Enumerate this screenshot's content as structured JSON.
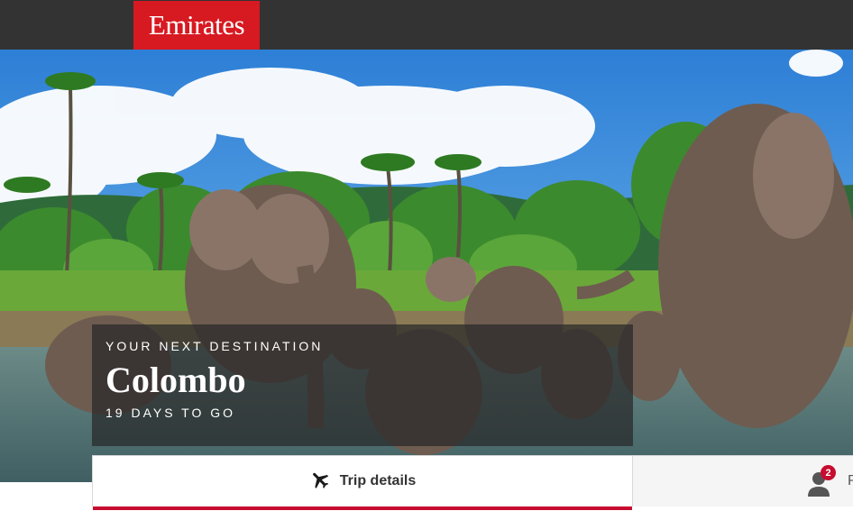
{
  "header": {
    "logo_text": "Emirates",
    "background_color": "#333333",
    "brand_color": "#d71921"
  },
  "hero": {
    "image_subject": "elephants bathing in river with palm trees",
    "eyebrow": "YOUR NEXT DESTINATION",
    "city": "Colombo",
    "countdown": "19 DAYS TO GO"
  },
  "tabs": {
    "trip_details": {
      "label": "Trip details",
      "icon": "airplane-icon",
      "active": true
    },
    "profile": {
      "label": "P",
      "icon": "person-icon",
      "badge_count": "2"
    },
    "accent_color": "#c60c30"
  }
}
